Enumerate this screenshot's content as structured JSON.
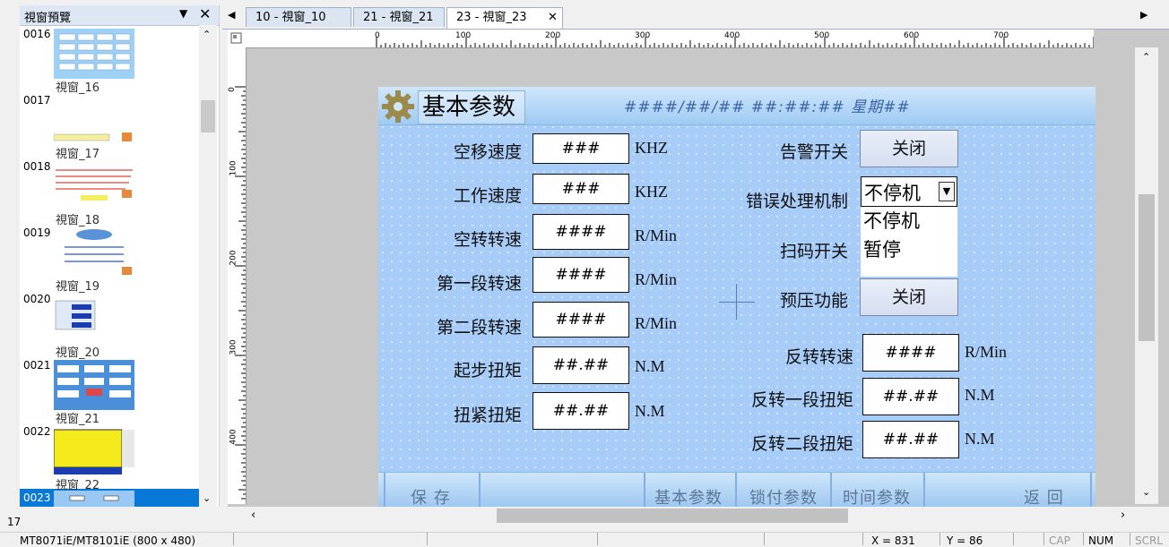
{
  "preview_panel": {
    "title": "視窗預覽",
    "menu_glyph": "▼",
    "close_glyph": "✕",
    "items": [
      {
        "num": "0016",
        "label": "視窗_16"
      },
      {
        "num": "0017",
        "label": "視窗_17"
      },
      {
        "num": "0018",
        "label": "視窗_18"
      },
      {
        "num": "0019",
        "label": "視窗_19"
      },
      {
        "num": "0020",
        "label": "視窗_20"
      },
      {
        "num": "0021",
        "label": "視窗_21"
      },
      {
        "num": "0022",
        "label": "視窗_22"
      },
      {
        "num": "0023",
        "label": ""
      }
    ],
    "selected": "0023",
    "side_fragment": "17"
  },
  "tabs": [
    {
      "label": "10 - 視窗_10",
      "active": false
    },
    {
      "label": "21 - 視窗_21",
      "active": false
    },
    {
      "label": "23 - 視窗_23",
      "active": true
    }
  ],
  "tab_close_glyph": "✕",
  "ruler": {
    "top": [
      "0",
      "100",
      "200",
      "300",
      "400",
      "500",
      "600",
      "700"
    ],
    "left": [
      "0",
      "100",
      "200",
      "300",
      "400"
    ]
  },
  "screen": {
    "title": "基本参数",
    "datetime": "####/##/## ##:##:## 星期##",
    "left_fields": [
      {
        "label": "空移速度",
        "value": "###",
        "unit": "KHZ"
      },
      {
        "label": "工作速度",
        "value": "###",
        "unit": "KHZ"
      },
      {
        "label": "空转转速",
        "value": "####",
        "unit": "R/Min"
      },
      {
        "label": "第一段转速",
        "value": "####",
        "unit": "R/Min"
      },
      {
        "label": "第二段转速",
        "value": "####",
        "unit": "R/Min"
      },
      {
        "label": "起步扭矩",
        "value": "##.##",
        "unit": "N.M"
      },
      {
        "label": "扭紧扭矩",
        "value": "##.##",
        "unit": "N.M"
      }
    ],
    "alarm": {
      "label": "告警开关",
      "button": "关闭"
    },
    "error_handling": {
      "label": "错误处理机制",
      "value": "不停机",
      "options": [
        "不停机",
        "暂停"
      ]
    },
    "scan": {
      "label": "扫码开关"
    },
    "preload": {
      "label": "预压功能",
      "button": "关闭"
    },
    "right_fields": [
      {
        "label": "反转转速",
        "value": "####",
        "unit": "R/Min"
      },
      {
        "label": "反转一段扭矩",
        "value": "##.##",
        "unit": "N.M"
      },
      {
        "label": "反转二段扭矩",
        "value": "##.##",
        "unit": "N.M"
      }
    ],
    "bottom_nav": {
      "save": "保 存",
      "basic": "基本参数",
      "lock": "锁付参数",
      "time": "时间参数",
      "back": "返 回"
    }
  },
  "status_bar": {
    "model": "MT8071iE/MT8101iE (800 x 480)",
    "x": "X = 831",
    "y": "Y = 86",
    "cap": "CAP",
    "num": "NUM",
    "scrl": "SCRL"
  },
  "colors": {
    "canvas_bg": "#a8ccf8",
    "selected_item": "#0a78d7",
    "datetime_text": "#3b63a8"
  }
}
